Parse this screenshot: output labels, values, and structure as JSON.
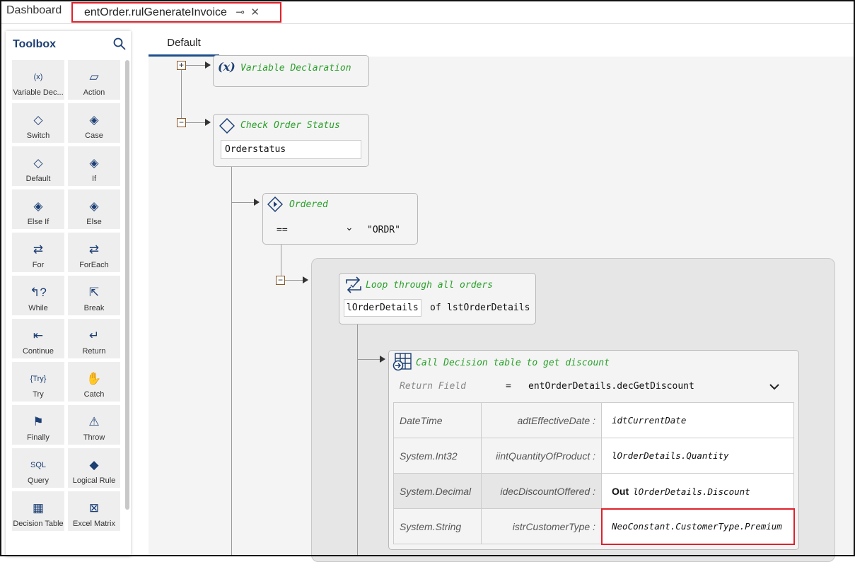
{
  "tabs": {
    "dashboard": "Dashboard",
    "active": "entOrder.rulGenerateInvoice",
    "pin": "⊸",
    "close": "✕"
  },
  "toolbox": {
    "title": "Toolbox",
    "items": [
      {
        "label": "Variable Dec...",
        "glyph": "(x)"
      },
      {
        "label": "Action",
        "glyph": "▱"
      },
      {
        "label": "Switch",
        "glyph": "◇"
      },
      {
        "label": "Case",
        "glyph": "◈"
      },
      {
        "label": "Default",
        "glyph": "◇"
      },
      {
        "label": "If",
        "glyph": "◈"
      },
      {
        "label": "Else If",
        "glyph": "◈"
      },
      {
        "label": "Else",
        "glyph": "◈"
      },
      {
        "label": "For",
        "glyph": "⇄"
      },
      {
        "label": "ForEach",
        "glyph": "⇄"
      },
      {
        "label": "While",
        "glyph": "↰?"
      },
      {
        "label": "Break",
        "glyph": "⇱"
      },
      {
        "label": "Continue",
        "glyph": "⇤"
      },
      {
        "label": "Return",
        "glyph": "↵"
      },
      {
        "label": "Try",
        "glyph": "{Try}"
      },
      {
        "label": "Catch",
        "glyph": "✋"
      },
      {
        "label": "Finally",
        "glyph": "⚑"
      },
      {
        "label": "Throw",
        "glyph": "⚠"
      },
      {
        "label": "Query",
        "glyph": "SQL"
      },
      {
        "label": "Logical Rule",
        "glyph": "◆"
      },
      {
        "label": "Decision Table",
        "glyph": "▦"
      },
      {
        "label": "Excel Matrix",
        "glyph": "⊠"
      }
    ]
  },
  "canvas_tab": "Default",
  "nodes": {
    "vardecl": {
      "icon": "(x)",
      "title": "Variable Declaration"
    },
    "switch": {
      "title": "Check Order Status",
      "value": "Orderstatus"
    },
    "case": {
      "title": "Ordered",
      "operator": "==",
      "value": "\"ORDR\""
    },
    "loop": {
      "title": "Loop through all orders",
      "item": "lOrderDetails",
      "of": "of",
      "collection": "lstOrderDetails"
    },
    "decision": {
      "title": "Call Decision table to get discount",
      "return_label": "Return Field",
      "eq": "=",
      "return_value": "entOrderDetails.decGetDiscount",
      "rows": [
        {
          "type": "DateTime",
          "param": "adtEffectiveDate :",
          "out": "",
          "value": "idtCurrentDate"
        },
        {
          "type": "System.Int32",
          "param": "iintQuantityOfProduct :",
          "out": "",
          "value": "lOrderDetails.Quantity"
        },
        {
          "type": "System.Decimal",
          "param": "idecDiscountOffered :",
          "out": "Out",
          "value": "lOrderDetails.Discount"
        },
        {
          "type": "System.String",
          "param": "istrCustomerType :",
          "out": "",
          "value": "NeoConstant.CustomerType.Premium"
        }
      ]
    }
  }
}
